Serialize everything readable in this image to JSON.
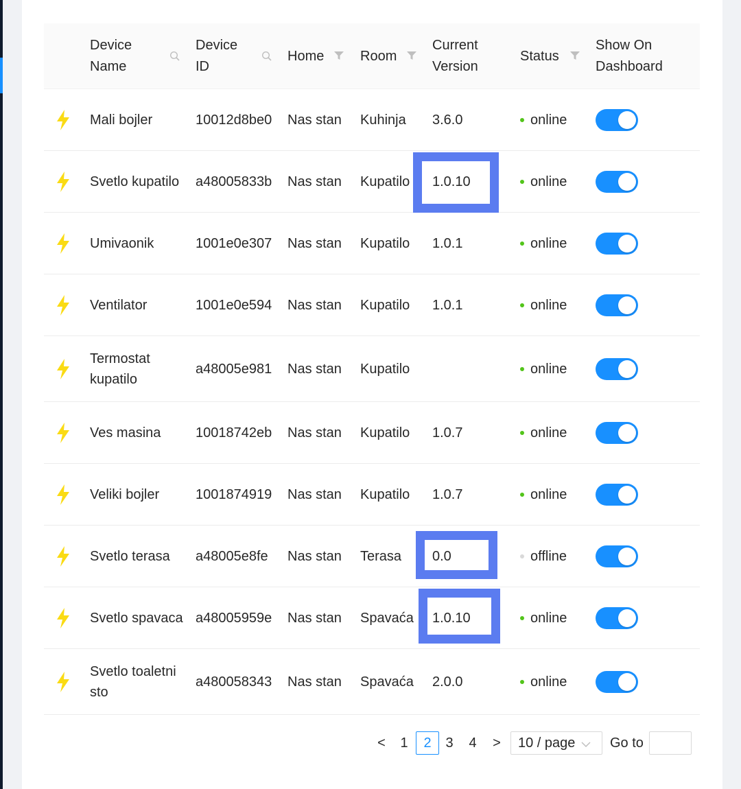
{
  "colors": {
    "accent": "#1890ff",
    "highlight": "#5b7cf0",
    "online": "#52c41a",
    "offline": "#d9d9d9",
    "bolt": "#fadb14"
  },
  "table": {
    "columns": [
      {
        "label": "Device\nName",
        "icon": "search-icon"
      },
      {
        "label": "Device\nID",
        "icon": "search-icon"
      },
      {
        "label": "Home",
        "icon": "filter-icon"
      },
      {
        "label": "Room",
        "icon": "filter-icon"
      },
      {
        "label": "Current\nVersion",
        "icon": ""
      },
      {
        "label": "Status",
        "icon": "filter-icon"
      },
      {
        "label": "Show On\nDashboard",
        "icon": ""
      }
    ],
    "rows": [
      {
        "name": "Mali bojler",
        "id": "10012d8be0",
        "home": "Nas stan",
        "room": "Kuhinja",
        "version": "3.6.0",
        "status": "online",
        "show_on_dashboard": true
      },
      {
        "name": "Svetlo kupatilo",
        "id": "a48005833b",
        "home": "Nas stan",
        "room": "Kupatilo",
        "version": "1.0.10",
        "status": "online",
        "show_on_dashboard": true
      },
      {
        "name": "Umivaonik",
        "id": "1001e0e307",
        "home": "Nas stan",
        "room": "Kupatilo",
        "version": "1.0.1",
        "status": "online",
        "show_on_dashboard": true
      },
      {
        "name": "Ventilator",
        "id": "1001e0e594",
        "home": "Nas stan",
        "room": "Kupatilo",
        "version": "1.0.1",
        "status": "online",
        "show_on_dashboard": true
      },
      {
        "name": "Termostat\nkupatilo",
        "id": "a48005e981",
        "home": "Nas stan",
        "room": "Kupatilo",
        "version": "",
        "status": "online",
        "show_on_dashboard": true
      },
      {
        "name": "Ves masina",
        "id": "10018742eb",
        "home": "Nas stan",
        "room": "Kupatilo",
        "version": "1.0.7",
        "status": "online",
        "show_on_dashboard": true
      },
      {
        "name": "Veliki bojler",
        "id": "1001874919",
        "home": "Nas stan",
        "room": "Kupatilo",
        "version": "1.0.7",
        "status": "online",
        "show_on_dashboard": true
      },
      {
        "name": "Svetlo terasa",
        "id": "a48005e8fe",
        "home": "Nas stan",
        "room": "Terasa",
        "version": "0.0",
        "status": "offline",
        "show_on_dashboard": true
      },
      {
        "name": "Svetlo spavaca",
        "id": "a48005959e",
        "home": "Nas stan",
        "room": "Spavaća",
        "version": "1.0.10",
        "status": "online",
        "show_on_dashboard": true
      },
      {
        "name": "Svetlo toaletni\nsto",
        "id": "a480058343",
        "home": "Nas stan",
        "room": "Spavaća",
        "version": "2.0.0",
        "status": "online",
        "show_on_dashboard": true
      }
    ]
  },
  "pagination": {
    "prev": "<",
    "next": ">",
    "pages": [
      "1",
      "2",
      "3",
      "4"
    ],
    "current": "2",
    "page_size": "10 / page",
    "goto_label": "Go to",
    "goto_value": ""
  }
}
